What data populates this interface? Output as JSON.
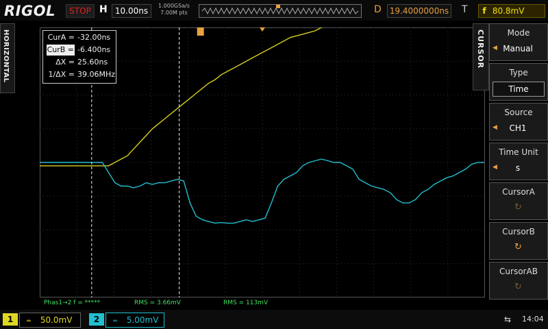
{
  "brand": "RIGOL",
  "status": {
    "run_state": "STOP",
    "run_color": "#e02020"
  },
  "horizontal": {
    "label": "H",
    "timebase": "10.00ns",
    "sample_rate": "1.000GSa/s",
    "mem_depth": "7.00M pts",
    "delay_label": "D",
    "delay": "19.4000000ns"
  },
  "trigger": {
    "label": "T",
    "symbol": "f",
    "level": "80.8mV",
    "color": "#f0e010"
  },
  "side_tabs": {
    "left": "HORIZONTAL",
    "right": "CURSOR"
  },
  "cursor_readout": {
    "cur_a_label": "CurA =",
    "cur_a_value": "-32.00ns",
    "cur_b_label": "CurB =",
    "cur_b_value": "-6.400ns",
    "dx_label": "ΔX =",
    "dx_value": "25.60ns",
    "inv_dx_label": "1/ΔX =",
    "inv_dx_value": "39.06MHz"
  },
  "measurements": {
    "phase": "Phas1→2 f = *****",
    "rms1": "RMS = 3.66mV",
    "rms2": "RMS = 113mV",
    "color": "#40e060"
  },
  "menu": {
    "mode": {
      "title": "Mode",
      "value": "Manual"
    },
    "type": {
      "title": "Type",
      "value": "Time"
    },
    "source": {
      "title": "Source",
      "value": "CH1"
    },
    "time_unit": {
      "title": "Time Unit",
      "value": "s"
    },
    "cursor_a": {
      "title": "CursorA",
      "icon": "rotary-knob-icon"
    },
    "cursor_b": {
      "title": "CursorB",
      "icon": "rotary-knob-icon"
    },
    "cursor_ab": {
      "title": "CursorAB",
      "icon": "rotary-knob-icon"
    }
  },
  "channels": [
    {
      "num": "1",
      "coupling": "DC",
      "scale": "50.0mV",
      "color": "#e0d820"
    },
    {
      "num": "2",
      "coupling": "DC",
      "scale": "5.00mV",
      "color": "#20c0d0"
    }
  ],
  "system": {
    "usb_icon": "usb-icon",
    "time": "14:04"
  },
  "waveform": {
    "ch1_color": "#d8d020",
    "ch2_color": "#20c0d0",
    "ch1_values_div": [
      -0.1,
      -0.1,
      -0.1,
      -0.1,
      -0.1,
      -0.1,
      -0.1,
      -0.1,
      -0.1,
      -0.1,
      -0.1,
      -0.1,
      0.0,
      0.1,
      0.2,
      0.4,
      0.6,
      0.8,
      1.0,
      1.15,
      1.3,
      1.45,
      1.6,
      1.75,
      1.9,
      2.05,
      2.2,
      2.35,
      2.45,
      2.6,
      2.7,
      2.8,
      2.9,
      3.0,
      3.1,
      3.2,
      3.3,
      3.4,
      3.5,
      3.6,
      3.7,
      3.75,
      3.8,
      3.85,
      3.9,
      4.0,
      4.05,
      4.1,
      4.15,
      4.2,
      4.25,
      4.3,
      4.35,
      4.4,
      4.45,
      4.5,
      4.55,
      4.6,
      4.65,
      4.7,
      4.7,
      4.75,
      4.8,
      4.8,
      4.85,
      4.85,
      4.9,
      4.9,
      4.9,
      4.95,
      5.0,
      5.0
    ],
    "ch2_values_div": [
      0.0,
      0.0,
      0.0,
      0.0,
      0.0,
      0.0,
      0.0,
      0.0,
      0.0,
      0.0,
      0.0,
      -0.3,
      -0.6,
      -0.7,
      -0.7,
      -0.75,
      -0.7,
      -0.6,
      -0.65,
      -0.6,
      -0.6,
      -0.55,
      -0.5,
      -0.55,
      -1.2,
      -1.6,
      -1.7,
      -1.75,
      -1.8,
      -1.78,
      -1.8,
      -1.8,
      -1.75,
      -1.7,
      -1.75,
      -1.7,
      -1.65,
      -1.2,
      -0.7,
      -0.5,
      -0.4,
      -0.3,
      -0.1,
      0.0,
      0.05,
      0.1,
      0.05,
      0.0,
      0.0,
      -0.1,
      -0.2,
      -0.5,
      -0.6,
      -0.7,
      -0.75,
      -0.8,
      -0.9,
      -1.1,
      -1.2,
      -1.2,
      -1.1,
      -0.9,
      -0.8,
      -0.65,
      -0.55,
      -0.45,
      -0.4,
      -0.3,
      -0.2,
      -0.05,
      0.0,
      0.0
    ],
    "cursor_a_div": 1.4,
    "cursor_b_div": 3.76
  }
}
